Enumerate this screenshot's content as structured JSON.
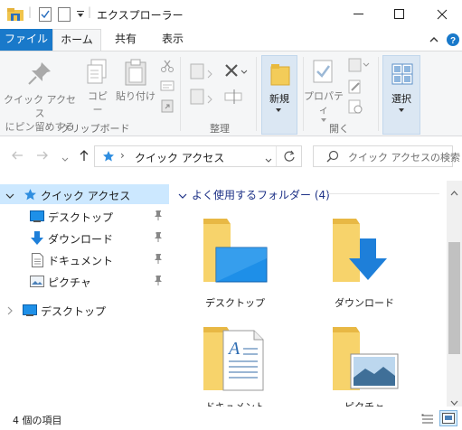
{
  "window": {
    "title": "エクスプローラー",
    "title_separator": "|"
  },
  "ribbon_tabs": {
    "file": "ファイル",
    "home": "ホーム",
    "share": "共有",
    "view": "表示"
  },
  "ribbon": {
    "clipboard": {
      "pin_label_1": "クイック アクセス",
      "pin_label_2": "にピン留めする",
      "copy": "コピー",
      "paste": "貼り付け",
      "group": "クリップボード"
    },
    "organize": {
      "group": "整理"
    },
    "new": {
      "new_label": "新規",
      "group": ""
    },
    "open": {
      "properties": "プロパティ",
      "group": "開く"
    },
    "select": {
      "select_label": "選択"
    }
  },
  "address": {
    "path": "クイック アクセス",
    "chevron": "›",
    "search_placeholder": "クイック アクセスの検索"
  },
  "sidebar": {
    "quick_access": "クイック アクセス",
    "items": [
      {
        "label": "デスクトップ"
      },
      {
        "label": "ダウンロード"
      },
      {
        "label": "ドキュメント"
      },
      {
        "label": "ピクチャ"
      }
    ],
    "desktop_root": "デスクトップ"
  },
  "main": {
    "group_header": "よく使用するフォルダー (4)",
    "folders": [
      {
        "label": "デスクトップ"
      },
      {
        "label": "ダウンロード"
      },
      {
        "label": "ドキュメント"
      },
      {
        "label": "ピクチャ"
      }
    ]
  },
  "status": {
    "item_count": "4 個の項目"
  },
  "colors": {
    "accent": "#1979ca",
    "folder": "#f7d36b",
    "selected": "#cce8ff"
  }
}
